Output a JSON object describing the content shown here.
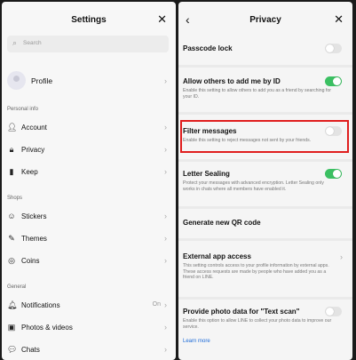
{
  "settings": {
    "title": "Settings",
    "search_placeholder": "Search",
    "profile_label": "Profile",
    "sections": {
      "personal": "Personal info",
      "shops": "Shops",
      "general": "General"
    },
    "items": [
      {
        "label": "Account",
        "icon": "person-icon"
      },
      {
        "label": "Privacy",
        "icon": "lock-icon"
      },
      {
        "label": "Keep",
        "icon": "bookmark-icon"
      },
      {
        "label": "Stickers",
        "icon": "smiley-icon"
      },
      {
        "label": "Themes",
        "icon": "brush-icon"
      },
      {
        "label": "Coins",
        "icon": "coin-icon"
      },
      {
        "label": "Notifications",
        "icon": "bell-icon",
        "value": "On"
      },
      {
        "label": "Photos & videos",
        "icon": "image-icon"
      },
      {
        "label": "Chats",
        "icon": "chat-icon"
      }
    ]
  },
  "privacy": {
    "title": "Privacy",
    "items": [
      {
        "title": "Passcode lock",
        "toggle": false
      },
      {
        "title": "Allow others to add me by ID",
        "desc": "Enable this setting to allow others to add you as a friend by searching for your ID.",
        "toggle": true
      },
      {
        "title": "Filter messages",
        "desc": "Enable this setting to reject messages not sent by your friends.",
        "toggle": false
      },
      {
        "title": "Letter Sealing",
        "desc": "Protect your messages with advanced encryption. Letter Sealing only works in chats where all members have enabled it.",
        "toggle": true
      },
      {
        "title": "Generate new QR code"
      },
      {
        "title": "External app access",
        "desc": "This setting controls access to your profile information by external apps. These access requests are made by people who have added you as a friend on LINE."
      },
      {
        "title": "Provide photo data for \"Text scan\"",
        "desc": "Enable this option to allow LINE to collect your photo data to improve our service.",
        "toggle": false
      }
    ],
    "learn_more": "Learn more"
  },
  "colors": {
    "toggle_on": "#3bc062",
    "highlight": "#e01e1e",
    "link": "#1b6ad8"
  }
}
